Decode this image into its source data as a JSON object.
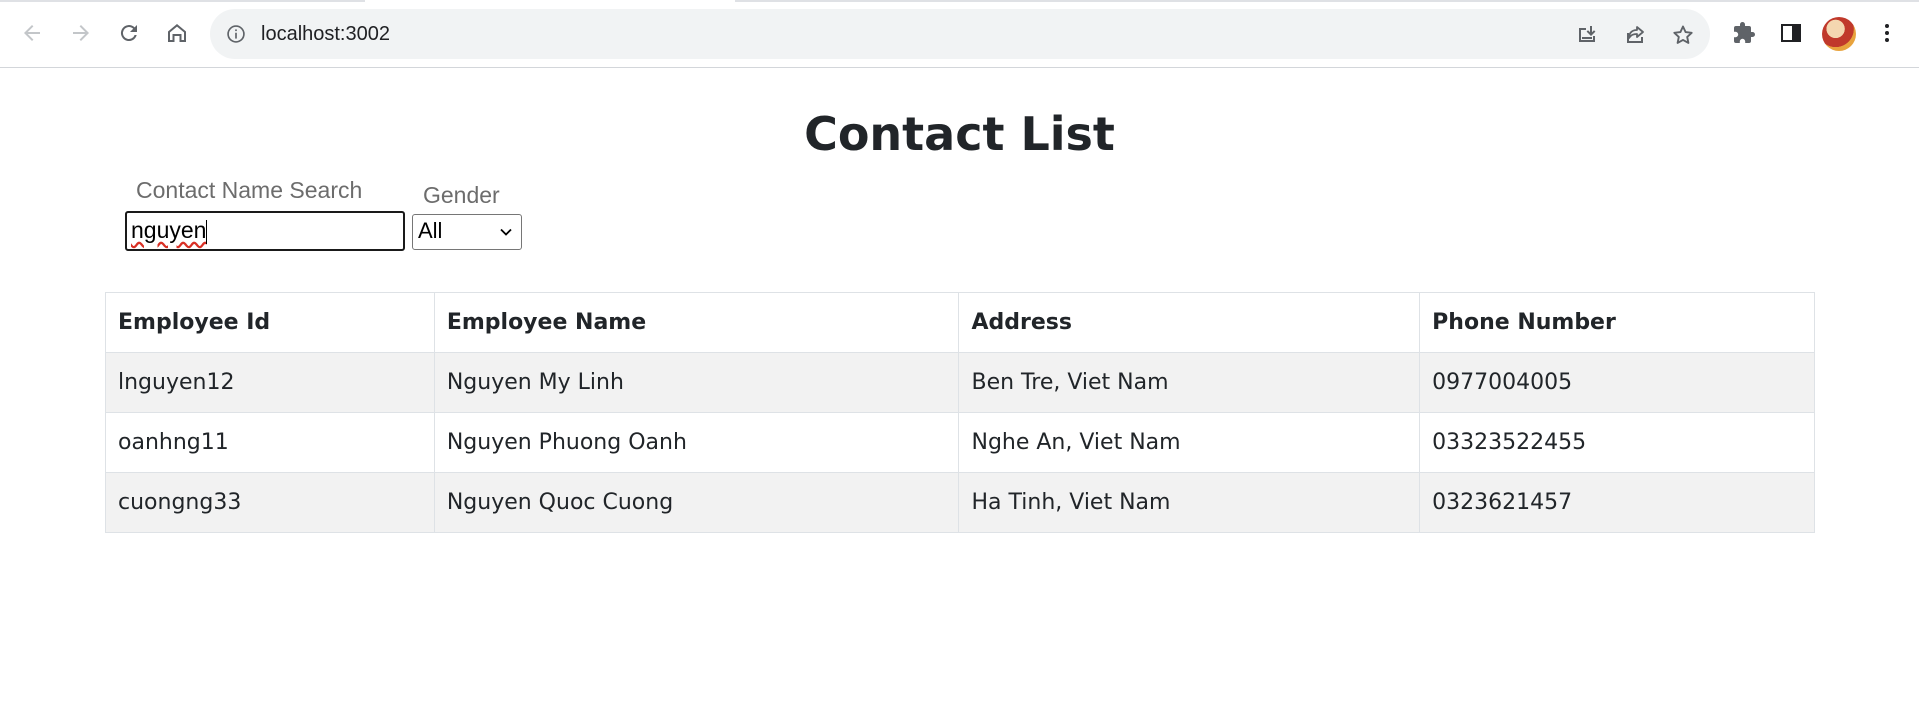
{
  "browser": {
    "url": "localhost:3002",
    "icons": {
      "back": "arrow-left-icon",
      "forward": "arrow-right-icon",
      "reload": "reload-icon",
      "home": "home-icon",
      "site_info": "info-icon",
      "install": "install-icon",
      "share": "share-icon",
      "bookmark": "star-icon",
      "extensions": "puzzle-icon",
      "side_panel": "side-panel-icon",
      "menu": "kebab-menu-icon"
    }
  },
  "page": {
    "title": "Contact List",
    "search": {
      "label": "Contact Name Search",
      "value": "nguyen"
    },
    "gender": {
      "label": "Gender",
      "selected": "All"
    }
  },
  "table": {
    "headers": [
      "Employee Id",
      "Employee Name",
      "Address",
      "Phone Number"
    ],
    "rows": [
      [
        "lnguyen12",
        "Nguyen My Linh",
        "Ben Tre, Viet Nam",
        "0977004005"
      ],
      [
        "oanhng11",
        "Nguyen Phuong Oanh",
        "Nghe An, Viet Nam",
        "03323522455"
      ],
      [
        "cuongng33",
        "Nguyen Quoc Cuong",
        "Ha Tinh, Viet Nam",
        "0323621457"
      ]
    ]
  },
  "colors": {
    "stripe": "#f2f2f2",
    "border": "#dee2e6",
    "text": "#212529",
    "omnibox": "#f1f3f4"
  }
}
